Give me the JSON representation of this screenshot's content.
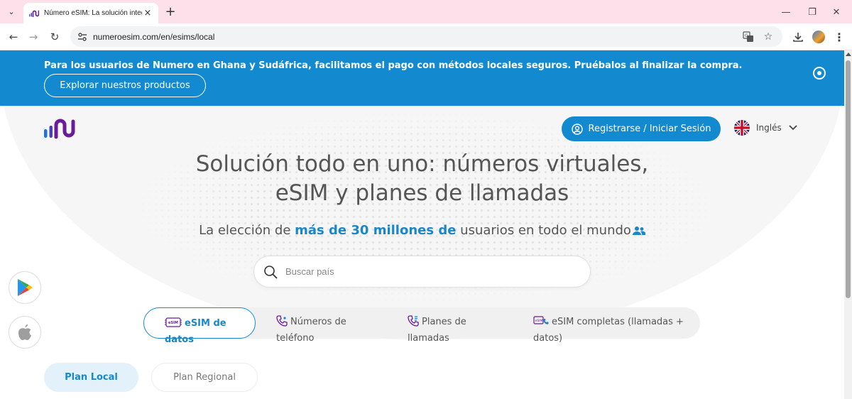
{
  "browser": {
    "tab_title": "Número eSIM: La solución integral",
    "url": "numeroesim.com/en/esims/local",
    "tab_close_glyph": "×",
    "new_tab_glyph": "+",
    "back_glyph": "←",
    "forward_glyph": "→",
    "reload_glyph": "↻",
    "minimize_glyph": "—",
    "restore_glyph": "❐",
    "close_glyph": "✕",
    "tab_dropdown_glyph": "⌄",
    "bookmark_glyph": "☆"
  },
  "banner": {
    "message": "Para los usuarios de Numero en Ghana y Sudáfrica, facilitamos el pago con métodos locales seguros. Pruébalos al finalizar la compra.",
    "cta_label": "Explorar nuestros productos"
  },
  "header": {
    "login_label": "Registrarse / Iniciar Sesión",
    "language_label": "Inglés"
  },
  "hero": {
    "title_line1": "Solución todo en uno: números virtuales,",
    "title_line2": "eSIM y planes de llamadas",
    "subtitle_pre": "La elección de ",
    "subtitle_highlight": "más de 30 millones de",
    "subtitle_post": " usuarios en todo el mundo"
  },
  "search": {
    "placeholder": "Buscar país"
  },
  "product_tabs": [
    {
      "line1": "eSIM de",
      "line2": "datos"
    },
    {
      "line1": "Números de",
      "line2": "teléfono"
    },
    {
      "line1": "Planes de",
      "line2": "llamadas"
    },
    {
      "line1": "eSIM completas (llamadas +",
      "line2": "datos)"
    }
  ],
  "plan_tabs": {
    "local": "Plan Local",
    "regional": "Plan Regional"
  },
  "colors": {
    "brand_blue": "#138ad0",
    "logo_purple": "#6a1b9a",
    "tab_strip_pink": "#fde0ea"
  },
  "icons": {
    "play_store": "google-play-icon",
    "app_store": "apple-icon"
  }
}
